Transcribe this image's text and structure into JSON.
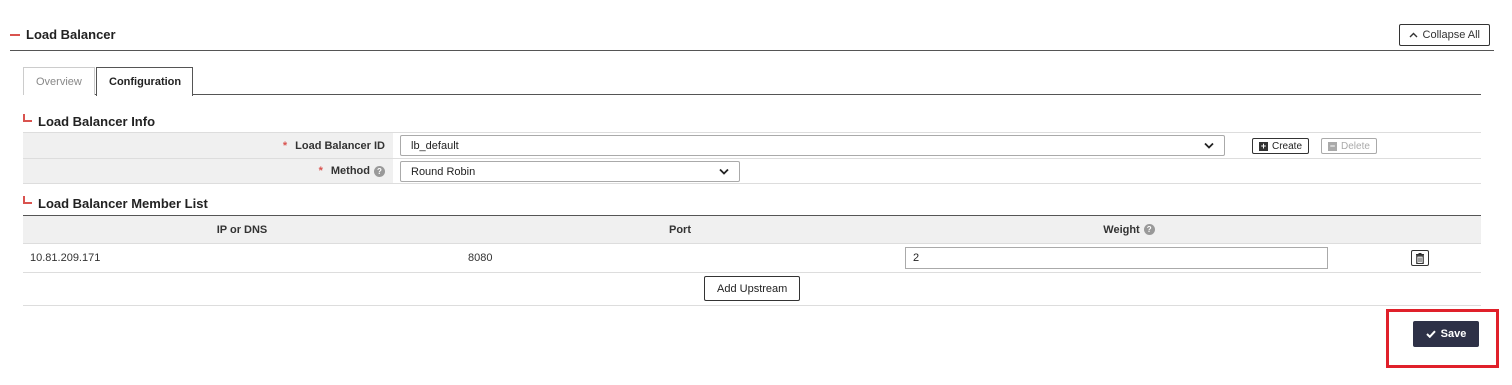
{
  "section": {
    "title": "Load Balancer",
    "collapse_all": "Collapse All"
  },
  "tabs": [
    {
      "label": "Overview"
    },
    {
      "label": "Configuration"
    }
  ],
  "info": {
    "title": "Load Balancer Info",
    "id_label": "Load Balancer ID",
    "id_value": "lb_default",
    "method_label": "Method",
    "method_value": "Round Robin",
    "required_mark": "*",
    "create_label": "Create",
    "delete_label": "Delete"
  },
  "members": {
    "title": "Load Balancer Member List",
    "columns": {
      "ip": "IP or DNS",
      "port": "Port",
      "weight": "Weight"
    },
    "rows": [
      {
        "ip": "10.81.209.171",
        "port": "8080",
        "weight": "2"
      }
    ],
    "add_label": "Add Upstream"
  },
  "footer": {
    "save_label": "Save"
  },
  "colors": {
    "accent_red": "#d9534f",
    "save_bg": "#2e3147",
    "highlight": "#e0202a"
  }
}
